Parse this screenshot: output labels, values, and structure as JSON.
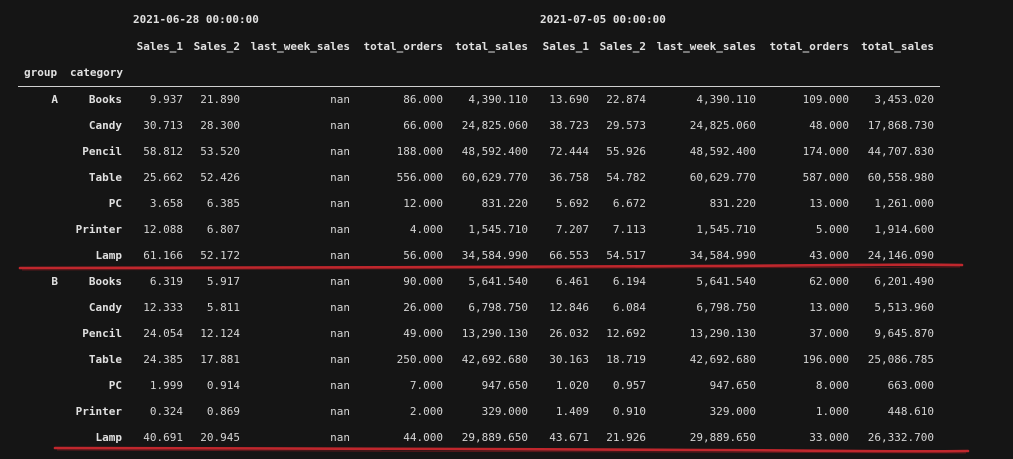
{
  "header": {
    "dates": [
      "2021-06-28 00:00:00",
      "2021-07-05 00:00:00"
    ],
    "columns": [
      "Sales_1",
      "Sales_2",
      "last_week_sales",
      "total_orders",
      "total_sales",
      "Sales_1",
      "Sales_2",
      "last_week_sales",
      "total_orders",
      "total_sales"
    ],
    "index_names": [
      "group",
      "category"
    ]
  },
  "rows": [
    {
      "group": "A",
      "category": "Books",
      "values": [
        "9.937",
        "21.890",
        "nan",
        "86.000",
        "4,390.110",
        "13.690",
        "22.874",
        "4,390.110",
        "109.000",
        "3,453.020"
      ]
    },
    {
      "group": "",
      "category": "Candy",
      "values": [
        "30.713",
        "28.300",
        "nan",
        "66.000",
        "24,825.060",
        "38.723",
        "29.573",
        "24,825.060",
        "48.000",
        "17,868.730"
      ]
    },
    {
      "group": "",
      "category": "Pencil",
      "values": [
        "58.812",
        "53.520",
        "nan",
        "188.000",
        "48,592.400",
        "72.444",
        "55.926",
        "48,592.400",
        "174.000",
        "44,707.830"
      ]
    },
    {
      "group": "",
      "category": "Table",
      "values": [
        "25.662",
        "52.426",
        "nan",
        "556.000",
        "60,629.770",
        "36.758",
        "54.782",
        "60,629.770",
        "587.000",
        "60,558.980"
      ]
    },
    {
      "group": "",
      "category": "PC",
      "values": [
        "3.658",
        "6.385",
        "nan",
        "12.000",
        "831.220",
        "5.692",
        "6.672",
        "831.220",
        "13.000",
        "1,261.000"
      ]
    },
    {
      "group": "",
      "category": "Printer",
      "values": [
        "12.088",
        "6.807",
        "nan",
        "4.000",
        "1,545.710",
        "7.207",
        "7.113",
        "1,545.710",
        "5.000",
        "1,914.600"
      ]
    },
    {
      "group": "",
      "category": "Lamp",
      "values": [
        "61.166",
        "52.172",
        "nan",
        "56.000",
        "34,584.990",
        "66.553",
        "54.517",
        "34,584.990",
        "43.000",
        "24,146.090"
      ]
    },
    {
      "group": "B",
      "category": "Books",
      "values": [
        "6.319",
        "5.917",
        "nan",
        "90.000",
        "5,641.540",
        "6.461",
        "6.194",
        "5,641.540",
        "62.000",
        "6,201.490"
      ]
    },
    {
      "group": "",
      "category": "Candy",
      "values": [
        "12.333",
        "5.811",
        "nan",
        "26.000",
        "6,798.750",
        "12.846",
        "6.084",
        "6,798.750",
        "13.000",
        "5,513.960"
      ]
    },
    {
      "group": "",
      "category": "Pencil",
      "values": [
        "24.054",
        "12.124",
        "nan",
        "49.000",
        "13,290.130",
        "26.032",
        "12.692",
        "13,290.130",
        "37.000",
        "9,645.870"
      ]
    },
    {
      "group": "",
      "category": "Table",
      "values": [
        "24.385",
        "17.881",
        "nan",
        "250.000",
        "42,692.680",
        "30.163",
        "18.719",
        "42,692.680",
        "196.000",
        "25,086.785"
      ]
    },
    {
      "group": "",
      "category": "PC",
      "values": [
        "1.999",
        "0.914",
        "nan",
        "7.000",
        "947.650",
        "1.020",
        "0.957",
        "947.650",
        "8.000",
        "663.000"
      ]
    },
    {
      "group": "",
      "category": "Printer",
      "values": [
        "0.324",
        "0.869",
        "nan",
        "2.000",
        "329.000",
        "1.409",
        "0.910",
        "329.000",
        "1.000",
        "448.610"
      ]
    },
    {
      "group": "",
      "category": "Lamp",
      "values": [
        "40.691",
        "20.945",
        "nan",
        "44.000",
        "29,889.650",
        "43.671",
        "21.926",
        "29,889.650",
        "33.000",
        "26,332.700"
      ]
    }
  ],
  "annotation_color": "#c0272d"
}
